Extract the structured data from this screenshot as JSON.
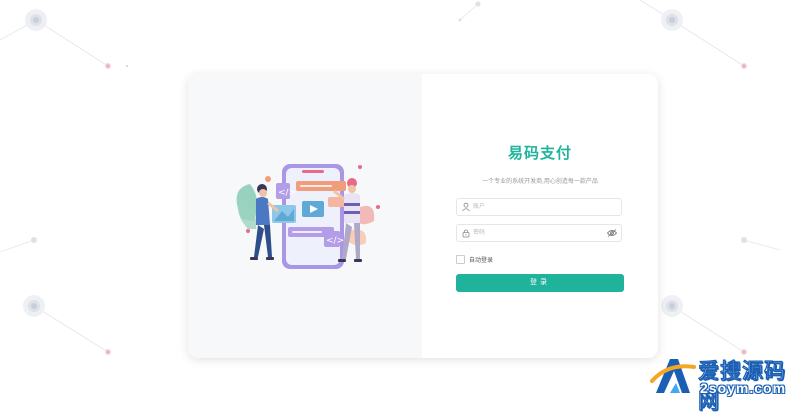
{
  "app": {
    "title": "易码支付",
    "subtitle": "一个专业的系统开发商,用心创造每一款产品"
  },
  "form": {
    "username_placeholder": "账户",
    "password_placeholder": "密码",
    "remember_label": "自动登录",
    "remember_checked": false,
    "submit_label": "登录"
  },
  "watermark": {
    "line1": "爱搜源码网",
    "line2": "2soym.com"
  },
  "icons": {
    "username": "user-icon",
    "password": "lock-icon",
    "visibility": "eye-icon"
  },
  "colors": {
    "accent": "#1fb39b",
    "panel_bg": "#f7f8fa",
    "watermark_blue": "#1a5fb4"
  }
}
